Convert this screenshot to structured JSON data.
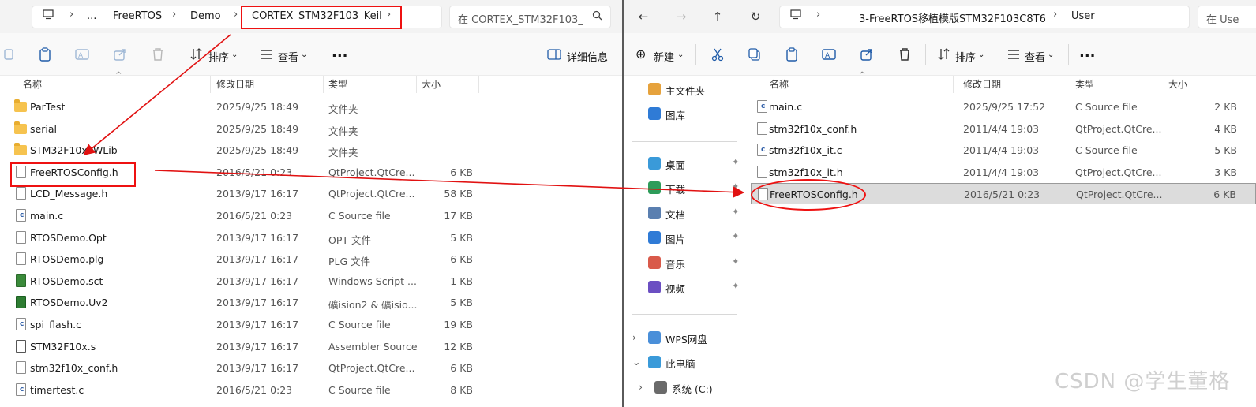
{
  "left": {
    "breadcrumbs": [
      "FreeRTOS",
      "Demo",
      "CORTEX_STM32F103_Keil"
    ],
    "overflow": "...",
    "search_placeholder": "在 CORTEX_STM32F103_",
    "toolbar": {
      "sort": "排序",
      "view": "查看",
      "more": "...",
      "details": "详细信息"
    },
    "columns": [
      "名称",
      "修改日期",
      "类型",
      "大小"
    ],
    "files": [
      {
        "name": "ParTest",
        "date": "2025/9/25 18:49",
        "type": "文件夹",
        "size": "",
        "icon": "folder-icon"
      },
      {
        "name": "serial",
        "date": "2025/9/25 18:49",
        "type": "文件夹",
        "size": "",
        "icon": "folder-icon"
      },
      {
        "name": "STM32F10xFWLib",
        "date": "2025/9/25 18:49",
        "type": "文件夹",
        "size": "",
        "icon": "folder-icon"
      },
      {
        "name": "FreeRTOSConfig.h",
        "date": "2016/5/21 0:23",
        "type": "QtProject.QtCre...",
        "size": "6 KB",
        "icon": "h-file-icon"
      },
      {
        "name": "LCD_Message.h",
        "date": "2013/9/17 16:17",
        "type": "QtProject.QtCre...",
        "size": "58 KB",
        "icon": "h-file-icon"
      },
      {
        "name": "main.c",
        "date": "2016/5/21 0:23",
        "type": "C Source file",
        "size": "17 KB",
        "icon": "c-file-icon"
      },
      {
        "name": "RTOSDemo.Opt",
        "date": "2013/9/17 16:17",
        "type": "OPT 文件",
        "size": "5 KB",
        "icon": "file-icon"
      },
      {
        "name": "RTOSDemo.plg",
        "date": "2013/9/17 16:17",
        "type": "PLG 文件",
        "size": "6 KB",
        "icon": "file-icon"
      },
      {
        "name": "RTOSDemo.sct",
        "date": "2013/9/17 16:17",
        "type": "Windows Script ...",
        "size": "1 KB",
        "icon": "script-file-icon"
      },
      {
        "name": "RTOSDemo.Uv2",
        "date": "2013/9/17 16:17",
        "type": "礦ision2 & 礦isio...",
        "size": "5 KB",
        "icon": "uvision-file-icon"
      },
      {
        "name": "spi_flash.c",
        "date": "2013/9/17 16:17",
        "type": "C Source file",
        "size": "19 KB",
        "icon": "c-file-icon"
      },
      {
        "name": "STM32F10x.s",
        "date": "2013/9/17 16:17",
        "type": "Assembler Source",
        "size": "12 KB",
        "icon": "asm-file-icon"
      },
      {
        "name": "stm32f10x_conf.h",
        "date": "2013/9/17 16:17",
        "type": "QtProject.QtCre...",
        "size": "6 KB",
        "icon": "h-file-icon"
      },
      {
        "name": "timertest.c",
        "date": "2016/5/21 0:23",
        "type": "C Source file",
        "size": "8 KB",
        "icon": "c-file-icon"
      }
    ]
  },
  "right": {
    "breadcrumbs": [
      "3-FreeRTOS移植模版STM32F103C8T6",
      "User"
    ],
    "search_placeholder": "在 Use",
    "toolbar": {
      "new": "新建",
      "sort": "排序",
      "view": "查看",
      "more": "..."
    },
    "columns": [
      "名称",
      "修改日期",
      "类型",
      "大小"
    ],
    "sidebar": [
      {
        "label": "主文件夹",
        "icon": "home-icon",
        "pinned": false
      },
      {
        "label": "图库",
        "icon": "gallery-icon",
        "pinned": false
      },
      {
        "label": "桌面",
        "icon": "desktop-icon",
        "pinned": true
      },
      {
        "label": "下载",
        "icon": "download-icon",
        "pinned": true
      },
      {
        "label": "文档",
        "icon": "documents-icon",
        "pinned": true
      },
      {
        "label": "图片",
        "icon": "pictures-icon",
        "pinned": true
      },
      {
        "label": "音乐",
        "icon": "music-icon",
        "pinned": true
      },
      {
        "label": "视频",
        "icon": "videos-icon",
        "pinned": true
      },
      {
        "label": "WPS网盘",
        "icon": "cloud-icon",
        "pinned": false
      },
      {
        "label": "此电脑",
        "icon": "pc-icon",
        "pinned": false
      },
      {
        "label": "系统 (C:)",
        "icon": "drive-icon",
        "pinned": false
      }
    ],
    "files": [
      {
        "name": "main.c",
        "date": "2025/9/25 17:52",
        "type": "C Source file",
        "size": "2 KB",
        "icon": "c-file-icon"
      },
      {
        "name": "stm32f10x_conf.h",
        "date": "2011/4/4 19:03",
        "type": "QtProject.QtCre...",
        "size": "4 KB",
        "icon": "h-file-icon"
      },
      {
        "name": "stm32f10x_it.c",
        "date": "2011/4/4 19:03",
        "type": "C Source file",
        "size": "5 KB",
        "icon": "c-file-icon"
      },
      {
        "name": "stm32f10x_it.h",
        "date": "2011/4/4 19:03",
        "type": "QtProject.QtCre...",
        "size": "3 KB",
        "icon": "h-file-icon"
      },
      {
        "name": "FreeRTOSConfig.h",
        "date": "2016/5/21 0:23",
        "type": "QtProject.QtCre...",
        "size": "6 KB",
        "icon": "h-file-icon",
        "selected": true
      }
    ]
  },
  "watermark": "CSDN @学生董格",
  "colors": {
    "annotation": "#e11111",
    "selection": "#dcdcdc"
  }
}
